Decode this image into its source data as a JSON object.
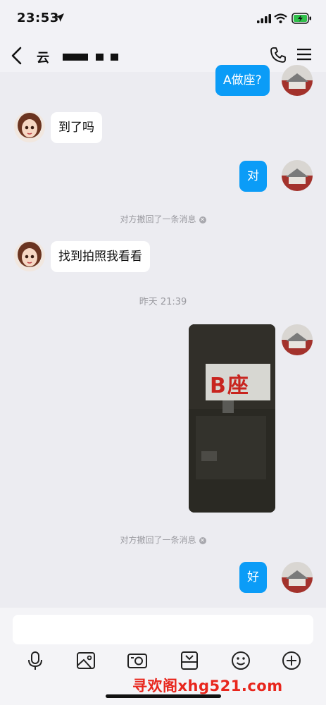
{
  "status_bar": {
    "time": "23:53"
  },
  "header": {
    "title": "云"
  },
  "messages": [
    {
      "side": "out",
      "text": "A做座?"
    },
    {
      "side": "in",
      "text": "到了吗"
    },
    {
      "side": "out",
      "text": "对"
    },
    {
      "side": "system",
      "text": "对方撤回了一条消息"
    },
    {
      "side": "in",
      "text": "找到拍照我看看"
    },
    {
      "side": "timestamp",
      "text": "昨天 21:39"
    },
    {
      "side": "out",
      "type": "photo",
      "photo_text": "B座"
    },
    {
      "side": "system",
      "text": "对方撤回了一条消息"
    },
    {
      "side": "out",
      "text": "好"
    }
  ],
  "toolbar": {
    "icons": [
      "mic-icon",
      "image-icon",
      "camera-icon",
      "file-icon",
      "emoji-icon",
      "plus-icon"
    ]
  },
  "watermark": {
    "text": "寻欢阁xhg521.com"
  },
  "colors": {
    "bubble_out": "#0b9cf7",
    "bubble_in": "#ffffff",
    "background": "#ececf1"
  }
}
